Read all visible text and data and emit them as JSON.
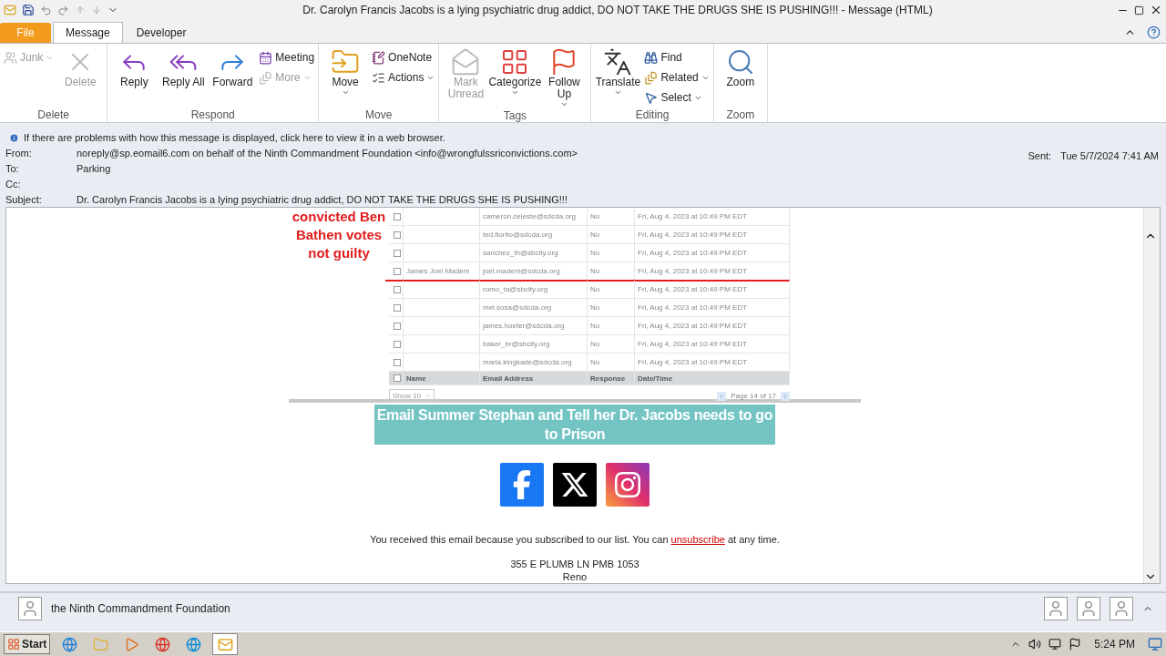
{
  "window": {
    "title": "Dr. Carolyn Francis Jacobs is a lying psychiatric drug addict, DO NOT TAKE THE DRUGS SHE IS PUSHING!!!  -  Message (HTML)"
  },
  "tabs": [
    {
      "label": "File",
      "kind": "file",
      "selected": false
    },
    {
      "label": "Message",
      "kind": "tab",
      "selected": true
    },
    {
      "label": "Developer",
      "kind": "tab",
      "selected": false
    }
  ],
  "ribbon": {
    "groups": [
      {
        "label": "Delete",
        "buttons": [
          {
            "label": "Junk",
            "kind": "small",
            "disabled": true,
            "caret": true
          },
          {
            "label": "Delete",
            "kind": "large",
            "disabled": true,
            "caret": false
          }
        ]
      },
      {
        "label": "Respond",
        "buttons": [
          {
            "label": "Reply",
            "kind": "large",
            "disabled": false,
            "caret": false
          },
          {
            "label": "Reply All",
            "kind": "large",
            "disabled": false,
            "caret": false
          },
          {
            "label": "Forward",
            "kind": "large",
            "disabled": false,
            "caret": false
          },
          {
            "label": "Meeting",
            "kind": "small",
            "disabled": false,
            "caret": false
          },
          {
            "label": "More",
            "kind": "small",
            "disabled": true,
            "caret": true
          }
        ]
      },
      {
        "label": "Move",
        "buttons": [
          {
            "label": "Move",
            "kind": "large",
            "disabled": false,
            "caret": true
          },
          {
            "label": "OneNote",
            "kind": "small",
            "disabled": false,
            "caret": false
          },
          {
            "label": "Actions",
            "kind": "small",
            "disabled": false,
            "caret": true
          }
        ]
      },
      {
        "label": "Tags",
        "buttons": [
          {
            "label": "Mark Unread",
            "kind": "large",
            "disabled": true,
            "caret": false
          },
          {
            "label": "Categorize",
            "kind": "large",
            "disabled": false,
            "caret": true
          },
          {
            "label": "Follow Up",
            "kind": "large",
            "disabled": false,
            "caret": true
          }
        ]
      },
      {
        "label": "Editing",
        "buttons": [
          {
            "label": "Translate",
            "kind": "large",
            "disabled": false,
            "caret": true
          },
          {
            "label": "Find",
            "kind": "small",
            "disabled": false,
            "caret": false
          },
          {
            "label": "Related",
            "kind": "small",
            "disabled": false,
            "caret": true
          },
          {
            "label": "Select",
            "kind": "small",
            "disabled": false,
            "caret": true
          }
        ]
      },
      {
        "label": "Zoom",
        "buttons": [
          {
            "label": "Zoom",
            "kind": "large",
            "disabled": false,
            "caret": false
          }
        ]
      }
    ]
  },
  "info_bar": "If there are problems with how this message is displayed, click here to view it in a web browser.",
  "headers": [
    {
      "label": "From:",
      "value": "noreply@sp.eomail6.com on behalf of the Ninth Commandment Foundation <info@wrongfulssriconvictions.com>"
    },
    {
      "label": "To:",
      "value": "Parking"
    },
    {
      "label": "Cc:"
    },
    {
      "label": "Subject:",
      "value": "Dr. Carolyn Francis Jacobs is a lying psychiatric drug addict, DO NOT TAKE THE DRUGS SHE IS PUSHING!!!"
    }
  ],
  "sent": {
    "label": "Sent:",
    "value": "Tue 5/7/2024 7:41 AM"
  },
  "message": {
    "image": {
      "caption": "convicted Ben Bathen votes not guilty",
      "rows": [
        {
          "name": "",
          "email": "cameron.celeste@sdcda.org",
          "response": "No",
          "date": "Fri, Aug 4, 2023 at 10:49 PM EDT",
          "checked": false,
          "underlined": false
        },
        {
          "name": "",
          "email": "ted.fiorito@sdcda.org",
          "response": "No",
          "date": "Fri, Aug 4, 2023 at 10:49 PM EDT",
          "checked": false,
          "underlined": false
        },
        {
          "name": "",
          "email": "sanchez_th@sbcity.org",
          "response": "No",
          "date": "Fri, Aug 4, 2023 at 10:49 PM EDT",
          "checked": false,
          "underlined": false
        },
        {
          "name": "James Joel Madem",
          "email": "joel.madem@sdcda.org",
          "response": "No",
          "date": "Fri, Aug 4, 2023 at 10:49 PM EDT",
          "checked": false,
          "underlined": true
        },
        {
          "name": "",
          "email": "romo_ta@sbcity.org",
          "response": "No",
          "date": "Fri, Aug 4, 2023 at 10:49 PM EDT",
          "checked": false,
          "underlined": false
        },
        {
          "name": "",
          "email": "mel.sosa@sdcda.org",
          "response": "No",
          "date": "Fri, Aug 4, 2023 at 10:49 PM EDT",
          "checked": false,
          "underlined": false
        },
        {
          "name": "",
          "email": "james.hoefer@sdcda.org",
          "response": "No",
          "date": "Fri, Aug 4, 2023 at 10:49 PM EDT",
          "checked": false,
          "underlined": false
        },
        {
          "name": "",
          "email": "baker_br@sbcity.org",
          "response": "No",
          "date": "Fri, Aug 4, 2023 at 10:49 PM EDT",
          "checked": false,
          "underlined": false
        },
        {
          "name": "",
          "email": "marla.kingkade@sdcda.org",
          "response": "No",
          "date": "Fri, Aug 4, 2023 at 10:49 PM EDT",
          "checked": false,
          "underlined": false
        }
      ],
      "columns": [
        "Name",
        "Email Address",
        "Response",
        "Date/Time"
      ],
      "all_checked": false,
      "show": "Show 10",
      "page": "Page 14 of 17"
    },
    "banner": "Email Summer Stephan and Tell her Dr. Jacobs needs to go to Prison",
    "social": [
      {
        "kind": "facebook"
      },
      {
        "kind": "x"
      },
      {
        "kind": "instagram"
      }
    ],
    "notice_before": "You received this email because you subscribed to our list. You can ",
    "notice_link": "unsubscribe",
    "notice_after": " at any time.",
    "address": [
      "355 E PLUMB LN PMB 1053",
      "Reno"
    ]
  },
  "people_pane": {
    "name": "the Ninth Commandment Foundation"
  },
  "taskbar": {
    "start": "Start",
    "apps": [
      {
        "kind": "ie",
        "selected": false
      },
      {
        "kind": "explorer",
        "selected": false
      },
      {
        "kind": "media",
        "selected": false
      },
      {
        "kind": "chrome",
        "selected": false
      },
      {
        "kind": "edge",
        "selected": false
      },
      {
        "kind": "outlook",
        "selected": true
      }
    ],
    "clock": "5:24 PM"
  }
}
